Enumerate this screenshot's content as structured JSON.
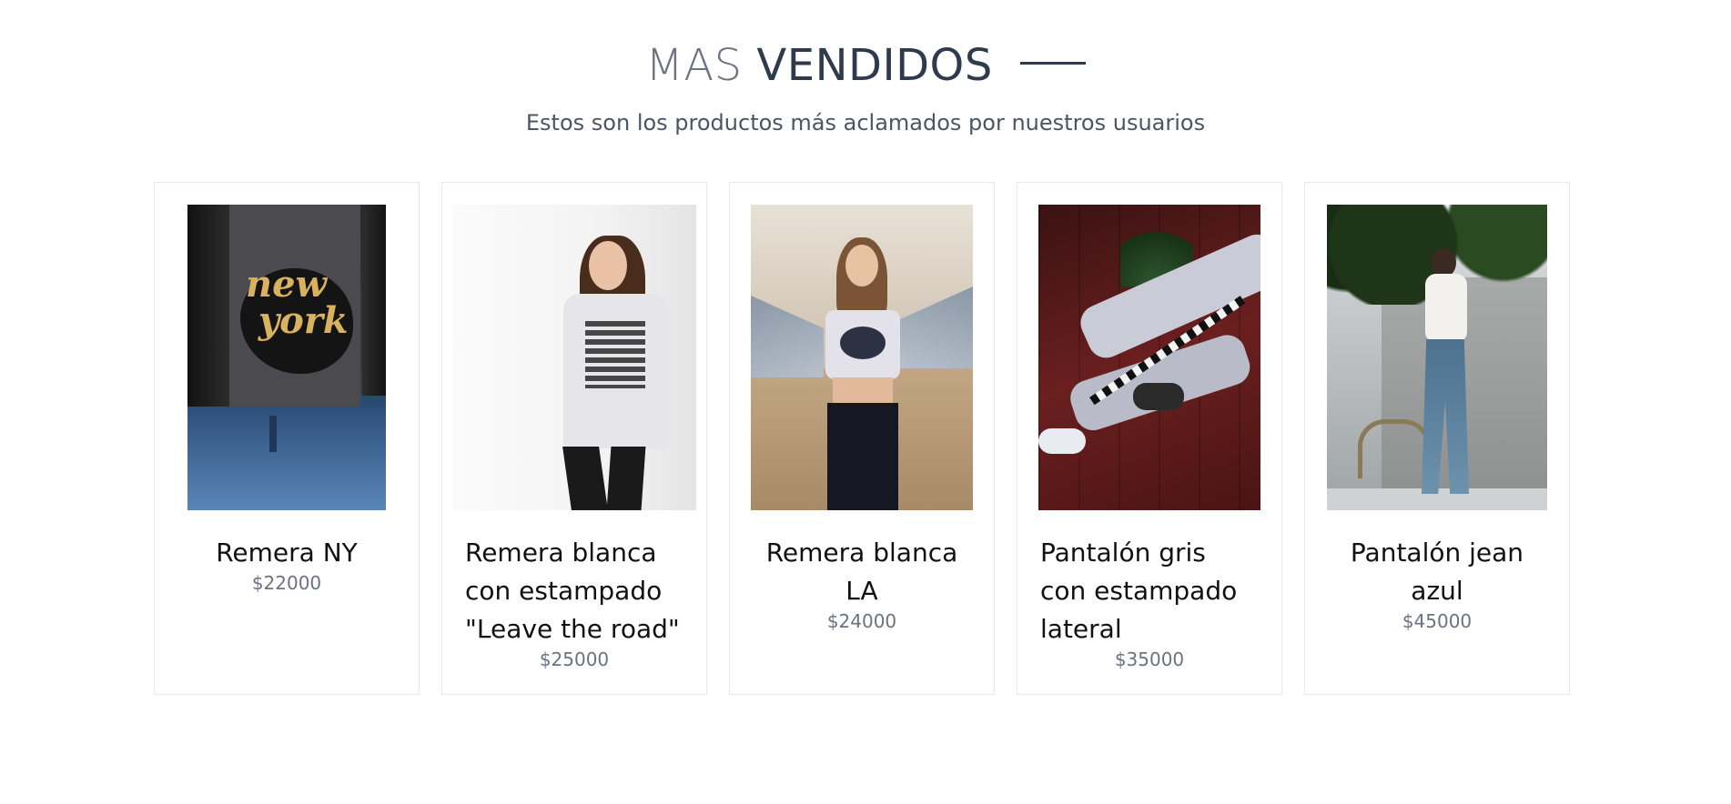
{
  "section": {
    "title_light": "MAS",
    "title_bold": "VENDIDOS",
    "subtitle": "Estos son los productos más aclamados por nuestros usuarios"
  },
  "products": [
    {
      "name": "Remera NY",
      "price": "$22000",
      "image_icon": "ny-tee-photo"
    },
    {
      "name": "Remera blanca con estampado \"Leave the road\"",
      "price": "$25000",
      "image_icon": "white-tee-photo"
    },
    {
      "name": "Remera blanca LA",
      "price": "$24000",
      "image_icon": "la-crop-top-photo"
    },
    {
      "name": "Pantalón gris con estampado lateral",
      "price": "$35000",
      "image_icon": "grey-pants-photo"
    },
    {
      "name": "Pantalón jean azul",
      "price": "$45000",
      "image_icon": "blue-jeans-photo"
    }
  ],
  "colors": {
    "title_light": "#6b7280",
    "title_dark": "#2f3a4d",
    "price": "#6b7280",
    "card_border": "#e8e8e8"
  }
}
